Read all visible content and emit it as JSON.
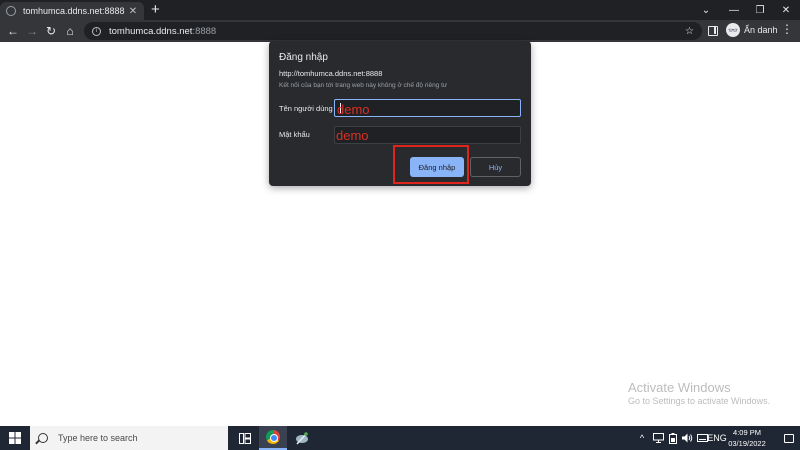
{
  "browser": {
    "tab_title": "tomhumca.ddns.net:8888",
    "tab_close": "✕",
    "new_tab": "+",
    "window_controls": {
      "collapse": "⌄",
      "minimize": "—",
      "restore": "❐",
      "close": "✕"
    },
    "nav": {
      "back": "←",
      "forward": "→",
      "reload": "↻",
      "home": "⌂"
    },
    "address": {
      "host": "tomhumca.ddns.net",
      "port": ":8888",
      "bookmark": "☆"
    },
    "incognito_label": "Ẩn danh",
    "menu": "⋮"
  },
  "dialog": {
    "title": "Đăng nhập",
    "url": "http://tomhumca.ddns.net:8888",
    "note": "Kết nối của bạn tới trang web này không ở chế độ riêng tư",
    "username_label": "Tên người dùng",
    "username_value": "",
    "password_label": "Mật khẩu",
    "password_value": "",
    "login_button": "Đăng nhập",
    "cancel_button": "Hủy"
  },
  "annotations": {
    "username_hint": "demo",
    "password_hint": "demo",
    "highlight_color": "#e0241c"
  },
  "watermark": {
    "title": "Activate Windows",
    "subtitle": "Go to Settings to activate Windows."
  },
  "taskbar": {
    "search_placeholder": "Type here to search",
    "tray": {
      "chevron": "^",
      "language": "ENG"
    },
    "clock": {
      "time": "4:09 PM",
      "date": "03/19/2022"
    }
  },
  "colors": {
    "accent": "#8ab4f8",
    "dialog_bg": "#292a2d",
    "browser_dark": "#202124",
    "taskbar": "#1f2634"
  }
}
